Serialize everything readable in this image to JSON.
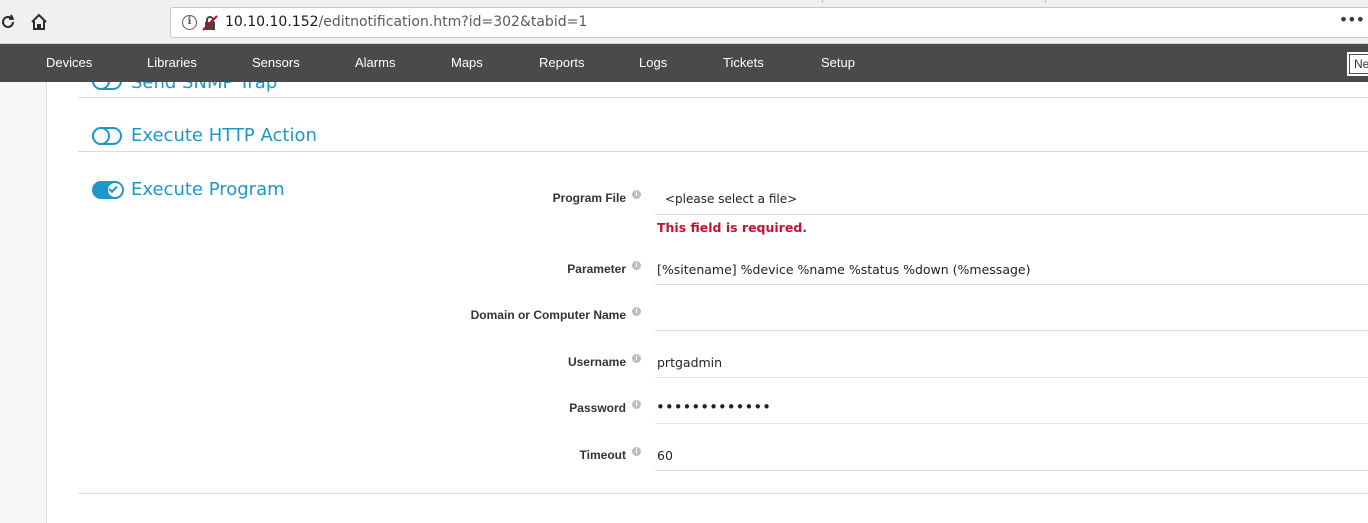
{
  "browser": {
    "url_host": "10.10.10.152",
    "url_path": "/editnotification.htm?id=302&tabid=1",
    "menu_glyph": "•••"
  },
  "nav": {
    "items": [
      "Devices",
      "Libraries",
      "Sensors",
      "Alarms",
      "Maps",
      "Reports",
      "Logs",
      "Tickets",
      "Setup"
    ],
    "new_button": "Ne"
  },
  "sections": {
    "snmp_title": "Send SNMP Trap",
    "http_title": "Execute HTTP Action",
    "program_title": "Execute Program"
  },
  "form": {
    "program_file": {
      "label": "Program File",
      "value": "<please select a file>",
      "error": "This field is required."
    },
    "parameter": {
      "label": "Parameter",
      "value": "[%sitename] %device %name %status %down (%message)"
    },
    "domain": {
      "label": "Domain or Computer Name",
      "value": ""
    },
    "username": {
      "label": "Username",
      "value": "prtgadmin"
    },
    "password": {
      "label": "Password",
      "value": "•••••••••••••"
    },
    "timeout": {
      "label": "Timeout",
      "value": "60"
    }
  },
  "colors": {
    "accent": "#1d97c9",
    "nav_bg": "#4a4a4a",
    "error": "#c8102e"
  },
  "icons": [
    "reload-icon",
    "home-icon",
    "info-icon",
    "insecure-lock-icon",
    "menu-dots-icon",
    "hint-icon"
  ]
}
